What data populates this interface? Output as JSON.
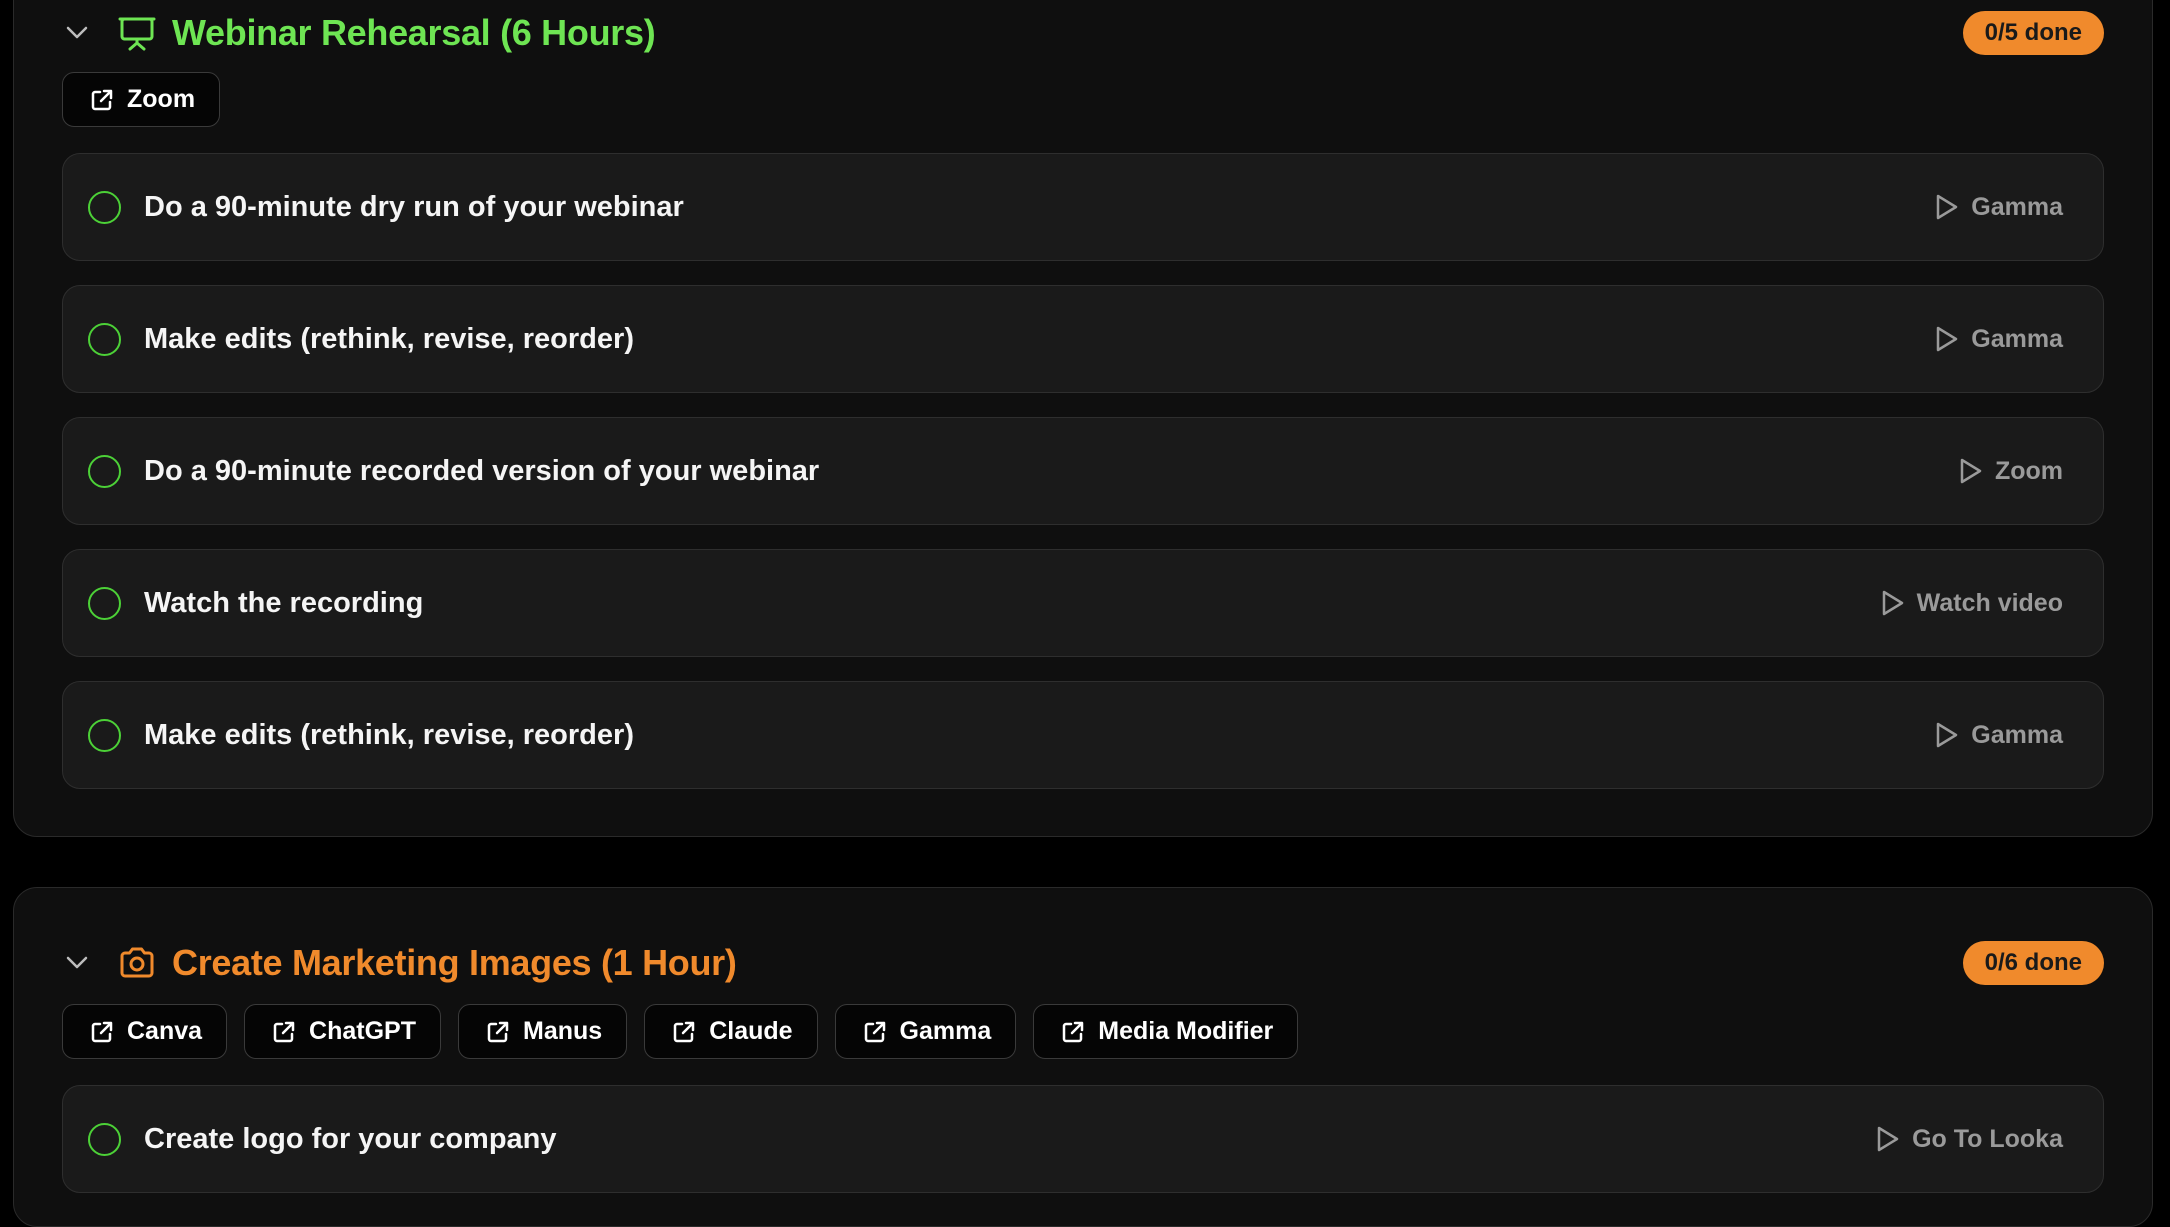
{
  "colors": {
    "page_background": "#000000",
    "section_background": "#0f0f0f",
    "task_background": "#1a1a1a",
    "check_green": "#4cd137",
    "badge_orange": "#f08a2c",
    "action_gray": "#9a9a9a"
  },
  "sections": [
    {
      "title": "Webinar Rehearsal (6 Hours)",
      "title_color": "#6ee553",
      "icon": "presentation-board-icon",
      "progress": "0/5 done",
      "tools": [
        {
          "label": "Zoom",
          "icon": "external-link-icon"
        }
      ],
      "tasks": [
        {
          "label": "Do a 90-minute dry run of your webinar",
          "action": "Gamma",
          "action_icon": "play-icon"
        },
        {
          "label": "Make edits (rethink, revise, reorder)",
          "action": "Gamma",
          "action_icon": "play-icon"
        },
        {
          "label": "Do a 90-minute recorded version of your webinar",
          "action": "Zoom",
          "action_icon": "play-icon"
        },
        {
          "label": "Watch the recording",
          "action": "Watch video",
          "action_icon": "play-icon"
        },
        {
          "label": "Make edits (rethink, revise, reorder)",
          "action": "Gamma",
          "action_icon": "play-icon"
        }
      ]
    },
    {
      "title": "Create Marketing Images (1 Hour)",
      "title_color": "#f08a2c",
      "icon": "camera-icon",
      "progress": "0/6 done",
      "tools": [
        {
          "label": "Canva",
          "icon": "external-link-icon"
        },
        {
          "label": "ChatGPT",
          "icon": "external-link-icon"
        },
        {
          "label": "Manus",
          "icon": "external-link-icon"
        },
        {
          "label": "Claude",
          "icon": "external-link-icon"
        },
        {
          "label": "Gamma",
          "icon": "external-link-icon"
        },
        {
          "label": "Media Modifier",
          "icon": "external-link-icon"
        }
      ],
      "tasks": [
        {
          "label": "Create logo for your company",
          "action": "Go To Looka",
          "action_icon": "play-icon"
        }
      ]
    }
  ]
}
